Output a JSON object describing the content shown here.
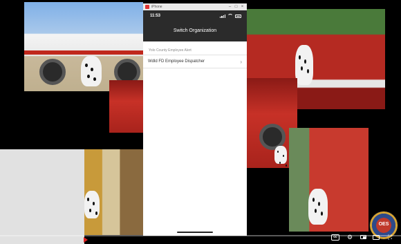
{
  "window": {
    "title": "iPhone"
  },
  "phone": {
    "status_time": "11:53",
    "screen_title": "Switch Organization",
    "section_label": "Yolo County Employee Alert",
    "rows": [
      {
        "label": "Wdld FD Employee Dispatcher"
      }
    ]
  },
  "watermark": {
    "text": "OES"
  },
  "player": {
    "captions_label": "cc",
    "progress": 0.0
  },
  "colors": {
    "header_bg": "#2b2b2b",
    "fire_red": "#c73127"
  },
  "icons": [
    "close-icon",
    "maximize-icon",
    "minimize-icon",
    "signal-icon",
    "wifi-icon",
    "battery-icon",
    "chevron-right-icon",
    "settings-icon",
    "miniplayer-icon",
    "theater-icon",
    "fullscreen-icon",
    "play-icon"
  ]
}
